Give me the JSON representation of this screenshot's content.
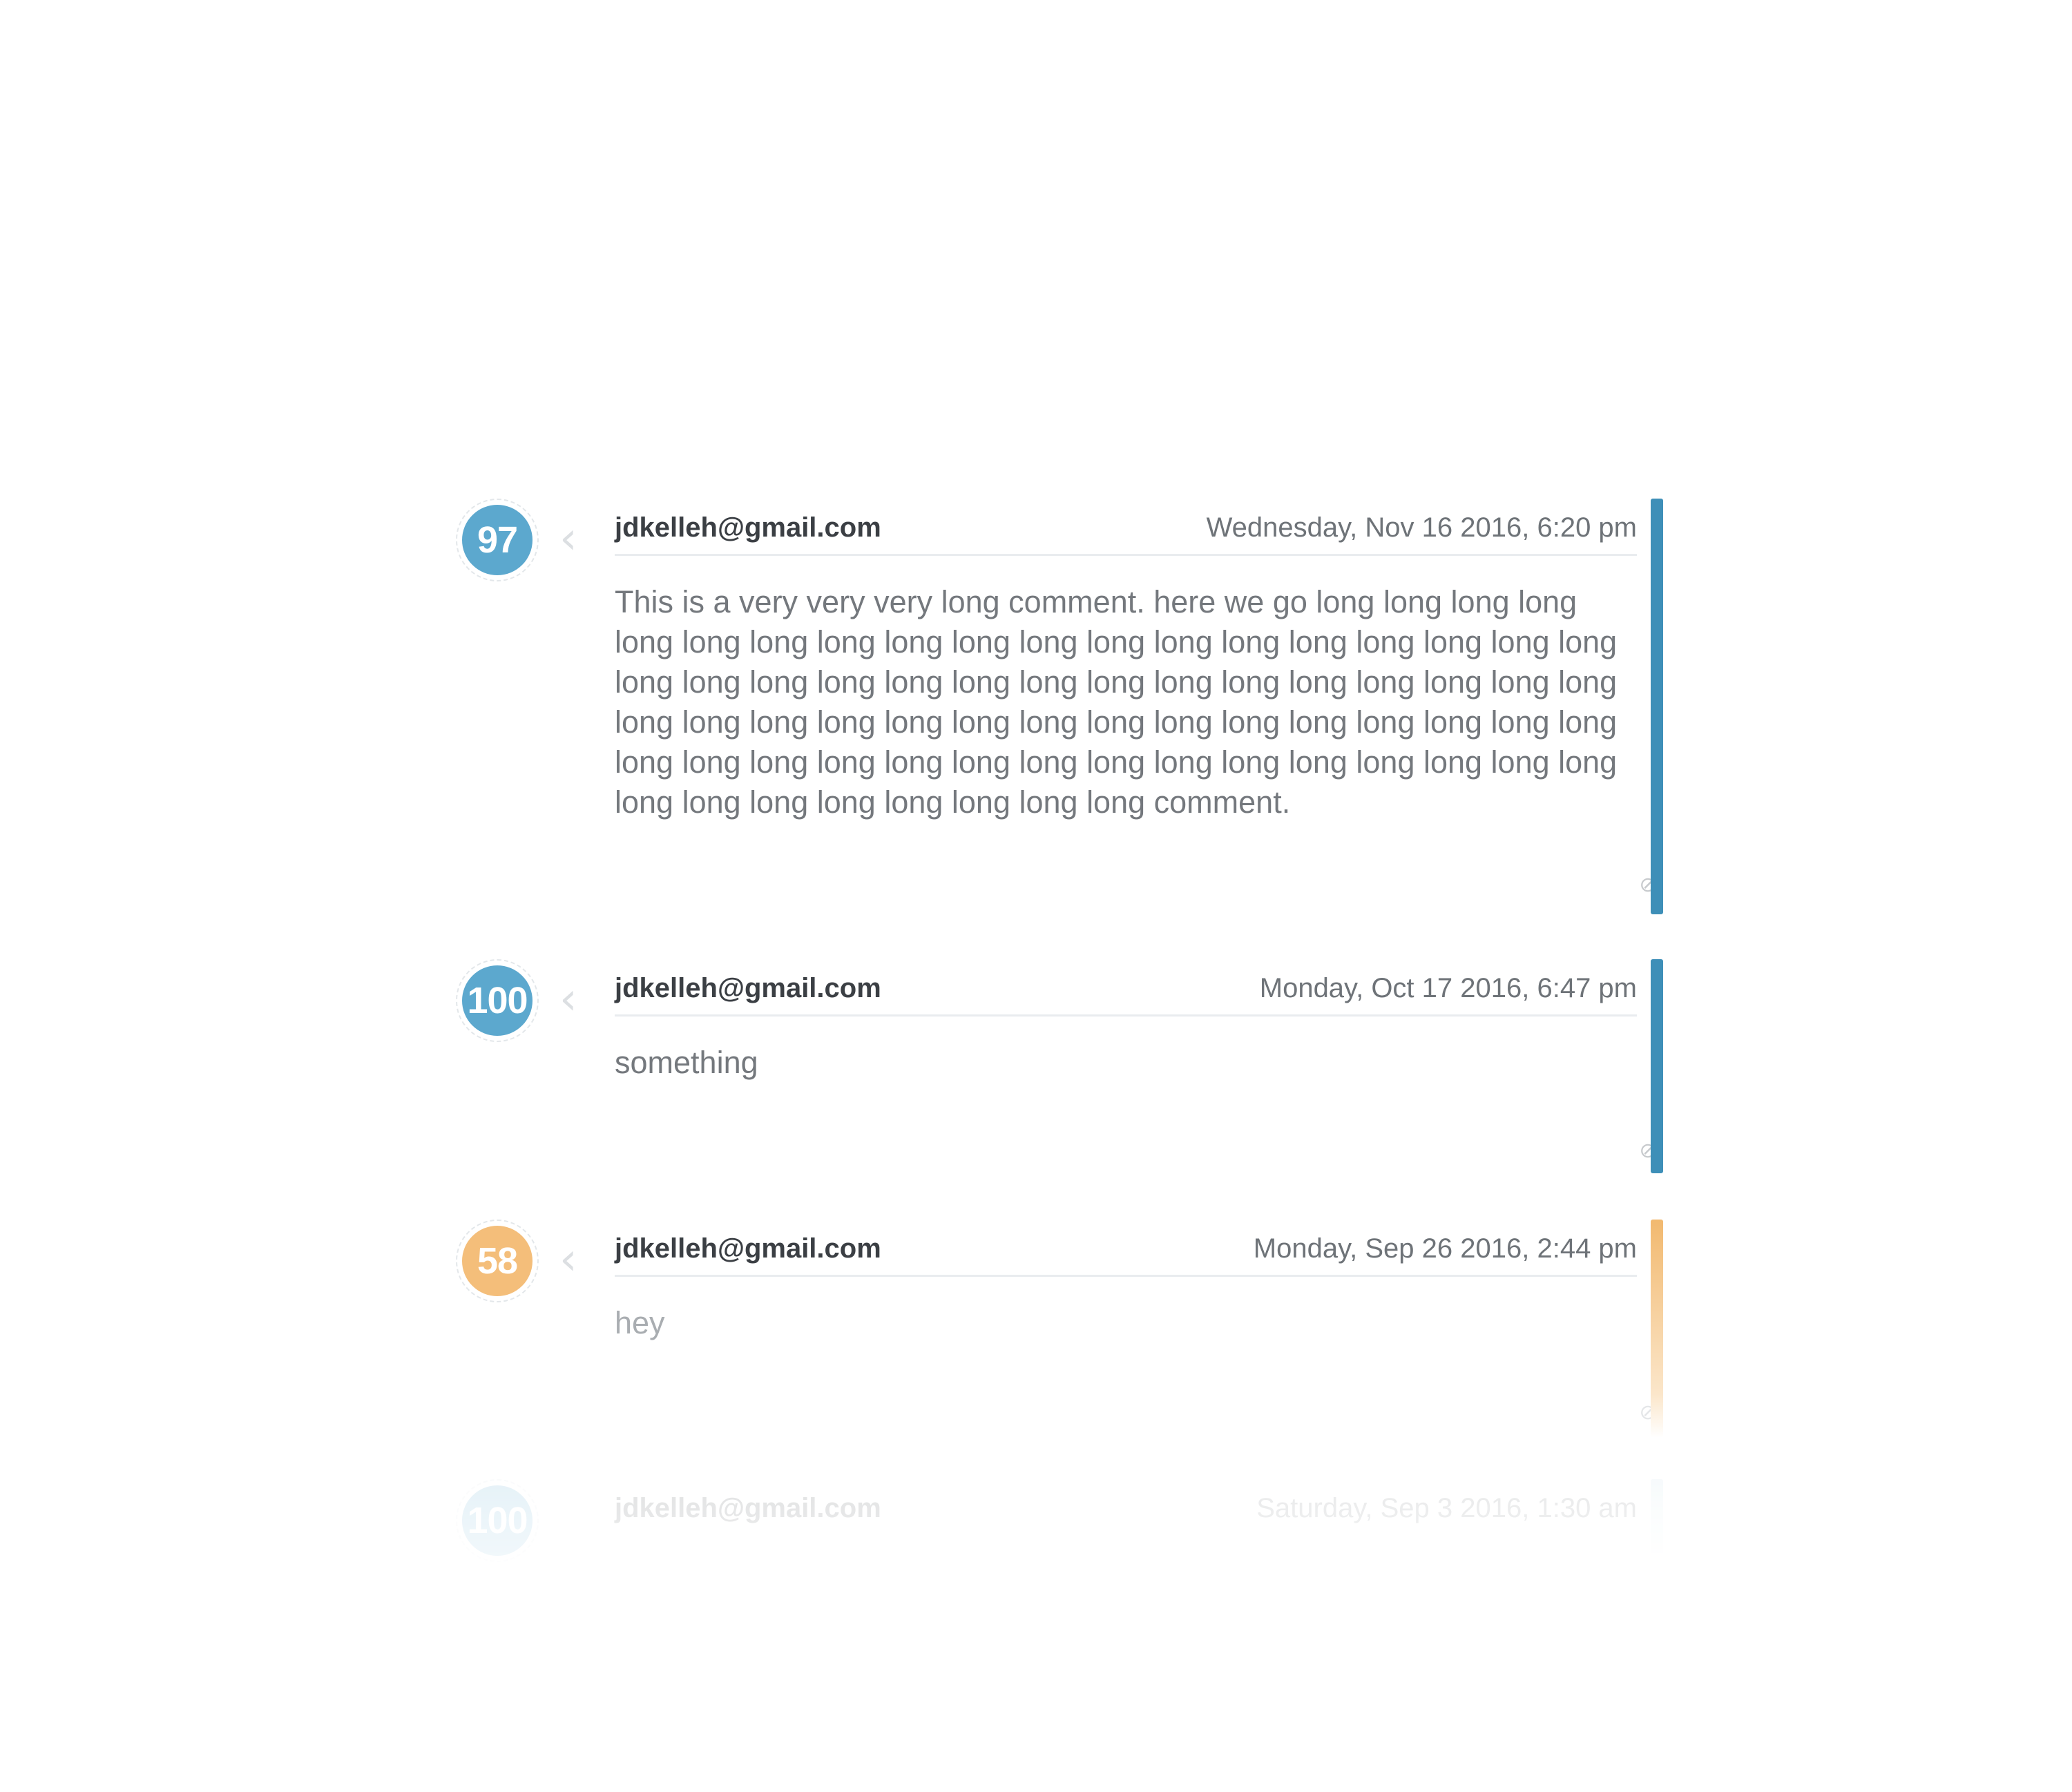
{
  "comments": [
    {
      "score": "97",
      "author": "jdkelleh@gmail.com",
      "date": "Wednesday, Nov 16 2016, 6:20 pm",
      "text": "This is a very very very long comment. here we go long long long long long long long long long long long long long long long long long long long long long long long long long long long long long long long long long long long long long long long long long long long long long long long long long long long long long long long long long long long long long long long long long long long long long long long long comment.",
      "accent": "#3e8fb8"
    },
    {
      "score": "100",
      "author": "jdkelleh@gmail.com",
      "date": "Monday, Oct 17 2016, 6:47 pm",
      "text": "something",
      "accent": "#3e8fb8"
    },
    {
      "score": "58",
      "author": "jdkelleh@gmail.com",
      "date": "Monday, Sep 26 2016, 2:44 pm",
      "text": "hey",
      "accent": "#f2b96f"
    },
    {
      "score": "100",
      "author": "jdkelleh@gmail.com",
      "date": "Saturday, Sep 3 2016, 1:30 am",
      "text": "",
      "accent": "#c9e0ec"
    }
  ],
  "icons": {
    "pointer": "chevron-left-icon",
    "flag": "flag-disabled-icon"
  }
}
